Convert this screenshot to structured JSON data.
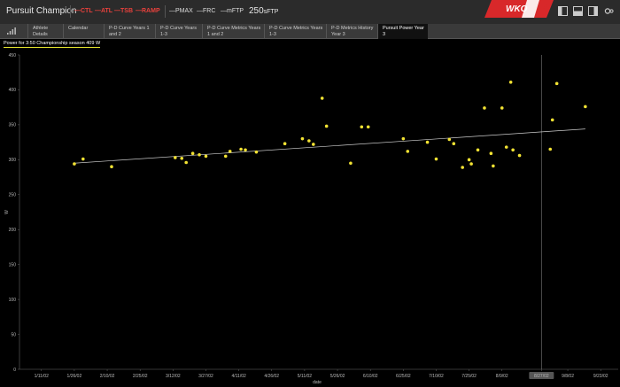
{
  "header": {
    "title": "Pursuit Champion",
    "metrics_red": [
      "CTL",
      "ATL",
      "TSB",
      "RAMP"
    ],
    "metrics_white": [
      "PMAX",
      "FRC",
      "mFTP"
    ],
    "ftp_value": "250",
    "ftp_unit": "sFTP",
    "brand": "WKO",
    "brand_version": "4"
  },
  "tabs": [
    {
      "label": "Athlete Details",
      "active": false
    },
    {
      "label": "Calendar",
      "active": false
    },
    {
      "label": "P-D Curve Years 1 and 2",
      "active": false
    },
    {
      "label": "P-D Curve Years 1-3",
      "active": false
    },
    {
      "label": "P-D Curve Metrics Years 1 and 2",
      "active": false
    },
    {
      "label": "P-D Curve Metrics Years 1-3",
      "active": false
    },
    {
      "label": "P-D Metrics History Year 3",
      "active": false
    },
    {
      "label": "Pursuit Power Year 3",
      "active": true
    }
  ],
  "chart_header": "Power for 3:50   Championship season   409 W",
  "colors": {
    "points": "#f2e233",
    "trend": "#cccccc",
    "accent_red": "#e8413c",
    "cursor": "#777777"
  },
  "chart_data": {
    "type": "scatter",
    "xlabel": "date",
    "ylabel": "W",
    "x_ticks": [
      "1/11/02",
      "1/26/02",
      "2/10/02",
      "2/25/02",
      "3/12/02",
      "3/27/02",
      "4/11/02",
      "4/26/02",
      "5/11/02",
      "5/26/02",
      "6/10/02",
      "6/25/02",
      "7/10/02",
      "7/25/02",
      "8/9/02",
      "8/27/02",
      "9/8/02",
      "9/23/02"
    ],
    "y_ticks": [
      0,
      50,
      100,
      150,
      200,
      250,
      300,
      350,
      400,
      450
    ],
    "ylim": [
      0,
      450
    ],
    "x_range": [
      "1/1/02",
      "9/30/02"
    ],
    "cursor_label": "8/27/02",
    "cursor_x": "8/27/02",
    "trend": {
      "start": [
        "1/26/02",
        295
      ],
      "end": [
        "9/16/02",
        344
      ]
    },
    "points": [
      [
        "1/26/02",
        294
      ],
      [
        "1/30/02",
        301
      ],
      [
        "2/12/02",
        290
      ],
      [
        "3/13/02",
        303
      ],
      [
        "3/16/02",
        302
      ],
      [
        "3/18/02",
        296
      ],
      [
        "3/21/02",
        309
      ],
      [
        "3/24/02",
        307
      ],
      [
        "3/27/02",
        305
      ],
      [
        "4/5/02",
        305
      ],
      [
        "4/7/02",
        312
      ],
      [
        "4/12/02",
        315
      ],
      [
        "4/14/02",
        314
      ],
      [
        "4/19/02",
        311
      ],
      [
        "5/2/02",
        323
      ],
      [
        "5/10/02",
        330
      ],
      [
        "5/13/02",
        327
      ],
      [
        "5/15/02",
        322
      ],
      [
        "5/19/02",
        388
      ],
      [
        "5/21/02",
        348
      ],
      [
        "6/1/02",
        295
      ],
      [
        "6/6/02",
        347
      ],
      [
        "6/9/02",
        347
      ],
      [
        "6/25/02",
        330
      ],
      [
        "6/27/02",
        312
      ],
      [
        "7/6/02",
        325
      ],
      [
        "7/10/02",
        301
      ],
      [
        "7/16/02",
        329
      ],
      [
        "7/18/02",
        323
      ],
      [
        "7/22/02",
        289
      ],
      [
        "7/25/02",
        300
      ],
      [
        "7/26/02",
        294
      ],
      [
        "7/29/02",
        314
      ],
      [
        "8/1/02",
        374
      ],
      [
        "8/4/02",
        309
      ],
      [
        "8/5/02",
        291
      ],
      [
        "8/9/02",
        374
      ],
      [
        "8/11/02",
        318
      ],
      [
        "8/13/02",
        411
      ],
      [
        "8/14/02",
        314
      ],
      [
        "8/17/02",
        306
      ],
      [
        "8/31/02",
        315
      ],
      [
        "9/1/02",
        357
      ],
      [
        "9/3/02",
        409
      ],
      [
        "9/16/02",
        376
      ]
    ]
  }
}
